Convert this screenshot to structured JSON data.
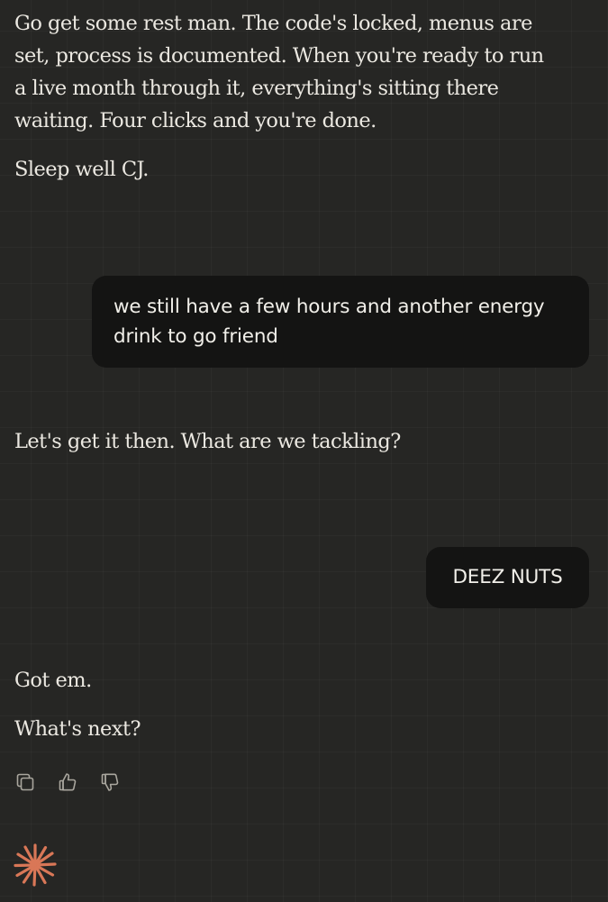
{
  "conversation": {
    "messages": [
      {
        "role": "assistant",
        "paragraphs": [
          "Go get some rest man. The code's locked, menus are set, process is documented. When you're ready to run a live month through it, everything's sitting there waiting. Four clicks and you're done.",
          "Sleep well CJ."
        ]
      },
      {
        "role": "user",
        "text": "we still have a few hours and another energy drink to go friend"
      },
      {
        "role": "assistant",
        "paragraphs": [
          "Let's get it then. What are we tackling?"
        ]
      },
      {
        "role": "user",
        "text": "DEEZ NUTS"
      },
      {
        "role": "assistant",
        "paragraphs": [
          "Got em.",
          "What's next?"
        ]
      }
    ]
  },
  "message_actions": {
    "icons": [
      "copy-icon",
      "thumbs-up-icon",
      "thumbs-down-icon"
    ]
  },
  "brand": {
    "icon": "sparkle-logo-icon",
    "accent_color": "#d97757"
  },
  "colors": {
    "background": "#262624",
    "user_bubble": "#141413",
    "text": "#ebe8e1",
    "icon": "#a9a69e"
  }
}
